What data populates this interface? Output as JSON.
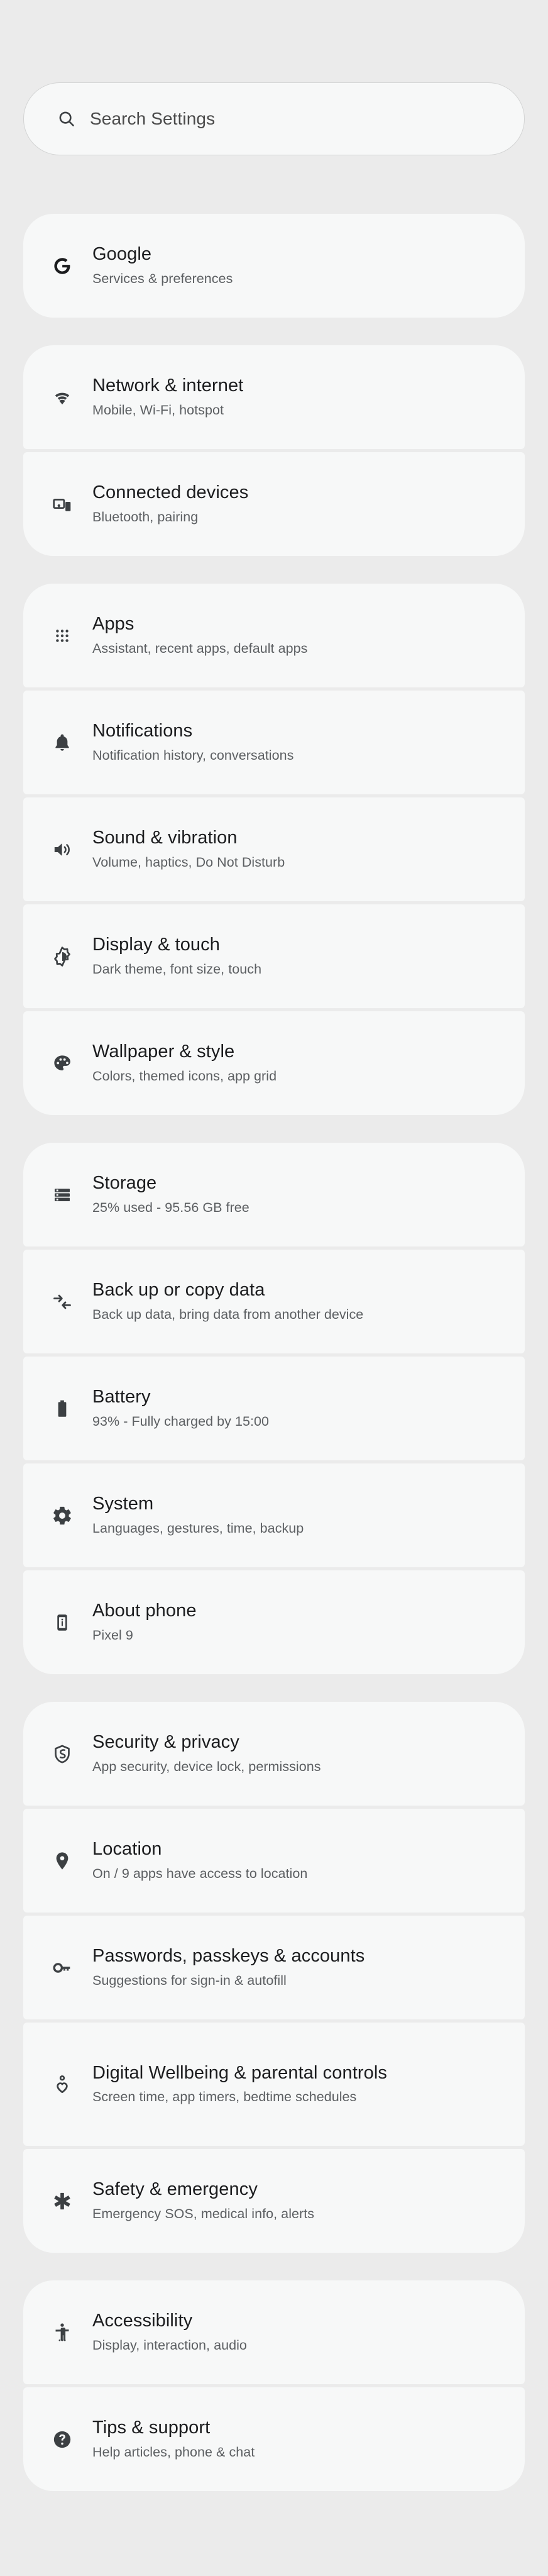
{
  "app": {
    "name": "Settings"
  },
  "search": {
    "placeholder": "Search Settings",
    "icon": "search-icon",
    "value": ""
  },
  "colors": {
    "background": "#ebebeb",
    "card": "#f7f8f8",
    "title_text": "#1b1c1e",
    "subtitle_text": "#5c5f62",
    "icon": "#3c4043"
  },
  "groups": [
    {
      "id": "group-google",
      "items": [
        {
          "id": "google",
          "icon": "google-g-icon",
          "title": "Google",
          "subtitle": "Services & preferences"
        }
      ]
    },
    {
      "id": "group-connectivity",
      "items": [
        {
          "id": "network-internet",
          "icon": "wifi-icon",
          "title": "Network & internet",
          "subtitle": "Mobile, Wi-Fi, hotspot"
        },
        {
          "id": "connected-devices",
          "icon": "connected-devices-icon",
          "title": "Connected devices",
          "subtitle": "Bluetooth, pairing"
        }
      ]
    },
    {
      "id": "group-device",
      "items": [
        {
          "id": "apps",
          "icon": "apps-grid-icon",
          "title": "Apps",
          "subtitle": "Assistant, recent apps, default apps"
        },
        {
          "id": "notifications",
          "icon": "bell-icon",
          "title": "Notifications",
          "subtitle": "Notification history, conversations"
        },
        {
          "id": "sound-vibration",
          "icon": "speaker-icon",
          "title": "Sound & vibration",
          "subtitle": "Volume, haptics, Do Not Disturb"
        },
        {
          "id": "display-touch",
          "icon": "brightness-icon",
          "title": "Display & touch",
          "subtitle": "Dark theme, font size, touch"
        },
        {
          "id": "wallpaper-style",
          "icon": "palette-icon",
          "title": "Wallpaper & style",
          "subtitle": "Colors, themed icons, app grid"
        }
      ]
    },
    {
      "id": "group-system",
      "items": [
        {
          "id": "storage",
          "icon": "storage-icon",
          "title": "Storage",
          "subtitle": "25% used - 95.56 GB free"
        },
        {
          "id": "backup-copy-data",
          "icon": "transfer-data-icon",
          "title": "Back up or copy data",
          "subtitle": "Back up data, bring data from another device"
        },
        {
          "id": "battery",
          "icon": "battery-icon",
          "title": "Battery",
          "subtitle": "93% - Fully charged by 15:00"
        },
        {
          "id": "system",
          "icon": "gear-icon",
          "title": "System",
          "subtitle": "Languages, gestures, time, backup"
        },
        {
          "id": "about-phone",
          "icon": "phone-info-icon",
          "title": "About phone",
          "subtitle": "Pixel 9"
        }
      ]
    },
    {
      "id": "group-privacy",
      "items": [
        {
          "id": "security-privacy",
          "icon": "shield-icon",
          "title": "Security & privacy",
          "subtitle": "App security, device lock, permissions"
        },
        {
          "id": "location",
          "icon": "location-pin-icon",
          "title": "Location",
          "subtitle": "On / 9 apps have access to location"
        },
        {
          "id": "passwords-passkeys-accounts",
          "icon": "key-icon",
          "title": "Passwords, passkeys & accounts",
          "subtitle": "Suggestions for sign-in & autofill"
        },
        {
          "id": "digital-wellbeing",
          "icon": "wellbeing-icon",
          "title": "Digital Wellbeing & parental controls",
          "subtitle": "Screen time, app timers, bedtime schedules"
        },
        {
          "id": "safety-emergency",
          "icon": "star-of-life-icon",
          "title": "Safety & emergency",
          "subtitle": "Emergency SOS, medical info, alerts"
        }
      ]
    },
    {
      "id": "group-help",
      "items": [
        {
          "id": "accessibility",
          "icon": "accessibility-icon",
          "title": "Accessibility",
          "subtitle": "Display, interaction, audio"
        },
        {
          "id": "tips-support",
          "icon": "help-circle-icon",
          "title": "Tips & support",
          "subtitle": "Help articles, phone & chat"
        }
      ]
    }
  ]
}
